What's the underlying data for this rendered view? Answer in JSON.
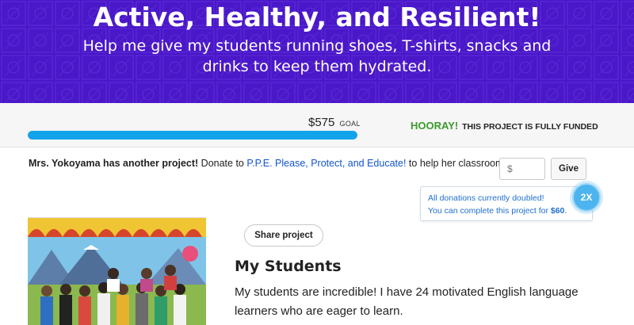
{
  "hero": {
    "title": "Active, Healthy, and Resilient!",
    "subtitle": "Help me give my students running shoes, T-shirts, snacks and drinks to keep them hydrated."
  },
  "funding": {
    "goal_amount": "$575",
    "goal_label": "GOAL",
    "progress_fraction": 1.0,
    "hooray": "HOORAY!",
    "funded_text": "THIS PROJECT IS FULLY FUNDED"
  },
  "another_project": {
    "teacher_text": "Mrs. Yokoyama has another project!",
    "donate_to": "Donate to",
    "project_link": "P.P.E. Please, Protect, and Educate!",
    "suffix": "to help her classroom."
  },
  "donate": {
    "amount_placeholder": "$",
    "give_label": "Give"
  },
  "match": {
    "line1": "All donations currently doubled!",
    "line2_prefix": "You can complete this project for",
    "amount": "$60",
    "line2_suffix": ".",
    "badge": "2X"
  },
  "share": {
    "label": "Share project"
  },
  "students": {
    "title": "My Students",
    "body": "My students are incredible! I have 24 motivated English language learners who are eager to learn."
  },
  "colors": {
    "hero_bg": "#4a17c9",
    "progress": "#13a3ea",
    "hooray": "#3b9a2d",
    "link": "#1155cc",
    "badge": "#4cb4ee"
  }
}
